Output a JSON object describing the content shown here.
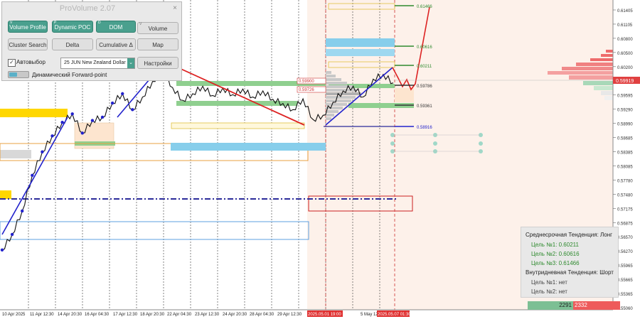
{
  "panel": {
    "title": "ProVolume 2.07",
    "close": "×",
    "buttons": [
      {
        "label": "Volume Profile",
        "state": "on",
        "corner": "V"
      },
      {
        "label": "Dynamic POC",
        "state": "on",
        "corner": "P"
      },
      {
        "label": "DOM",
        "state": "on",
        "corner": "D"
      },
      {
        "label": "Volume",
        "state": "off",
        "corner": "V"
      },
      {
        "label": "Cluster Search",
        "state": "off",
        "corner": ""
      },
      {
        "label": "Delta",
        "state": "off",
        "corner": ""
      },
      {
        "label": "Cumulative Δ",
        "state": "off",
        "corner": ""
      },
      {
        "label": "Map",
        "state": "off",
        "corner": ""
      }
    ],
    "auto_select_label": "Автовыбор",
    "auto_select_checked": "✓",
    "instrument": "25 JUN New Zealand Dollar",
    "settings_label": "Настройки",
    "forward_point_label": "Динамический Forward-point"
  },
  "trend": {
    "medium_title": "Среднесрочная Тенденция: Лонг",
    "medium_targets": [
      "Цель №1: 0.60211",
      "Цель №2: 0.60616",
      "Цель №3: 0.61466"
    ],
    "intraday_title": "Внутридневная Тенденция: Шорт",
    "intraday_targets": [
      "Цель №1: нет",
      "Цель №2: нет"
    ]
  },
  "volume_bar": {
    "buy": "2291",
    "sell": "2332"
  },
  "colors": {
    "up": "#2f7f6f",
    "down": "#e03030",
    "trend_line": "#2222cc",
    "current_price": "#e04040"
  },
  "chart_data": {
    "type": "line",
    "title": "",
    "y_ticks": [
      "0.61405",
      "0.61105",
      "0.60800",
      "0.60500",
      "0.60200",
      "0.59919",
      "0.59595",
      "0.59290",
      "0.58990",
      "0.58685",
      "0.58385",
      "0.58085",
      "0.57780",
      "0.57480",
      "0.57175",
      "0.56875",
      "0.56570",
      "0.56270",
      "0.55965",
      "0.55665",
      "0.55365",
      "0.55060"
    ],
    "current_price": "0.59919",
    "x_ticks": [
      "10 Apr 2025",
      "11 Apr 12:30",
      "14 Apr 20:30",
      "16 Apr 04:30",
      "17 Apr 12:30",
      "18 Apr 20:30",
      "22 Apr 04:30",
      "23 Apr 12:30",
      "24 Apr 20:30",
      "28 Apr 04:30",
      "29 Apr 12:30",
      "5 May 12",
      "2025.05.01 19:00",
      "2025.05.07 01:30"
    ],
    "level_labels": [
      "0.61466",
      "0.60616",
      "0.60211",
      "0.59786",
      "0.59361",
      "0.58916"
    ],
    "profile_labels": [
      "0.59900",
      "0.59726"
    ],
    "price_series": [
      [
        "10 Apr",
        0.5629
      ],
      [
        "10 Apr",
        0.5662
      ],
      [
        "11 Apr",
        0.5712
      ],
      [
        "11 Apr",
        0.5788
      ],
      [
        "11 Apr",
        0.5838
      ],
      [
        "14 Apr",
        0.5872
      ],
      [
        "14 Apr",
        0.5901
      ],
      [
        "14 Apr",
        0.5919
      ],
      [
        "16 Apr",
        0.5878
      ],
      [
        "16 Apr",
        0.5905
      ],
      [
        "16 Apr",
        0.5912
      ],
      [
        "17 Apr",
        0.5942
      ],
      [
        "17 Apr",
        0.5962
      ],
      [
        "17 Apr",
        0.5928
      ],
      [
        "18 Apr",
        0.5955
      ],
      [
        "18 Apr",
        0.5988
      ],
      [
        "22 Apr",
        0.6012
      ],
      [
        "22 Apr",
        0.5975
      ],
      [
        "22 Apr",
        0.5948
      ],
      [
        "23 Apr",
        0.5962
      ],
      [
        "23 Apr",
        0.5978
      ],
      [
        "23 Apr",
        0.5958
      ],
      [
        "24 Apr",
        0.5974
      ],
      [
        "24 Apr",
        0.596
      ],
      [
        "24 Apr",
        0.5972
      ],
      [
        "28 Apr",
        0.5955
      ],
      [
        "28 Apr",
        0.5968
      ],
      [
        "28 Apr",
        0.595
      ],
      [
        "29 Apr",
        0.5941
      ],
      [
        "29 Apr",
        0.5928
      ],
      [
        "29 Apr",
        0.5951
      ],
      [
        "1 May",
        0.5907
      ],
      [
        "1 May",
        0.5916
      ],
      [
        "2 May",
        0.5944
      ],
      [
        "2 May",
        0.5968
      ],
      [
        "5 May",
        0.5978
      ],
      [
        "5 May",
        0.5955
      ],
      [
        "6 May",
        0.5993
      ],
      [
        "6 May",
        0.6003
      ],
      [
        "7 May",
        0.5985
      ]
    ]
  }
}
